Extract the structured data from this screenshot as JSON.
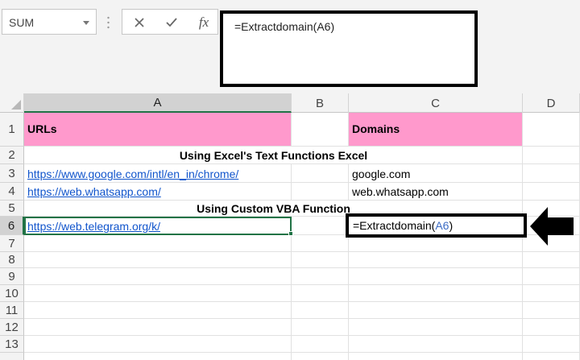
{
  "name_box": {
    "value": "SUM"
  },
  "formula_bar": {
    "cancel_icon": "close-icon",
    "enter_icon": "checkmark-icon",
    "fx_label": "fx",
    "formula_text": "=Extractdomain(A6)"
  },
  "columns": [
    "A",
    "B",
    "C",
    "D"
  ],
  "rows": [
    "1",
    "2",
    "3",
    "4",
    "5",
    "6",
    "7",
    "8",
    "9",
    "10",
    "11",
    "12",
    "13"
  ],
  "cells": {
    "A1": "URLs",
    "C1": "Domains",
    "A2_merged": "Using Excel's Text Functions Excel",
    "A3": "https://www.google.com/intl/en_in/chrome/",
    "C3": "google.com",
    "A4": "https://web.whatsapp.com/",
    "C4": "web.whatsapp.com",
    "A5_merged": "Using Custom VBA Function",
    "A6": "https://web.telegram.org/k/",
    "C6_formula_prefix": "=Extractdomain(",
    "C6_formula_ref": "A6",
    "C6_formula_suffix": ")"
  },
  "active_cell": "A6",
  "colors": {
    "header_fill": "#ff99cc",
    "hyperlink": "#1155cc",
    "selection_green": "#217346",
    "cell_reference": "#3c6cc4",
    "annotation": "#000000"
  }
}
